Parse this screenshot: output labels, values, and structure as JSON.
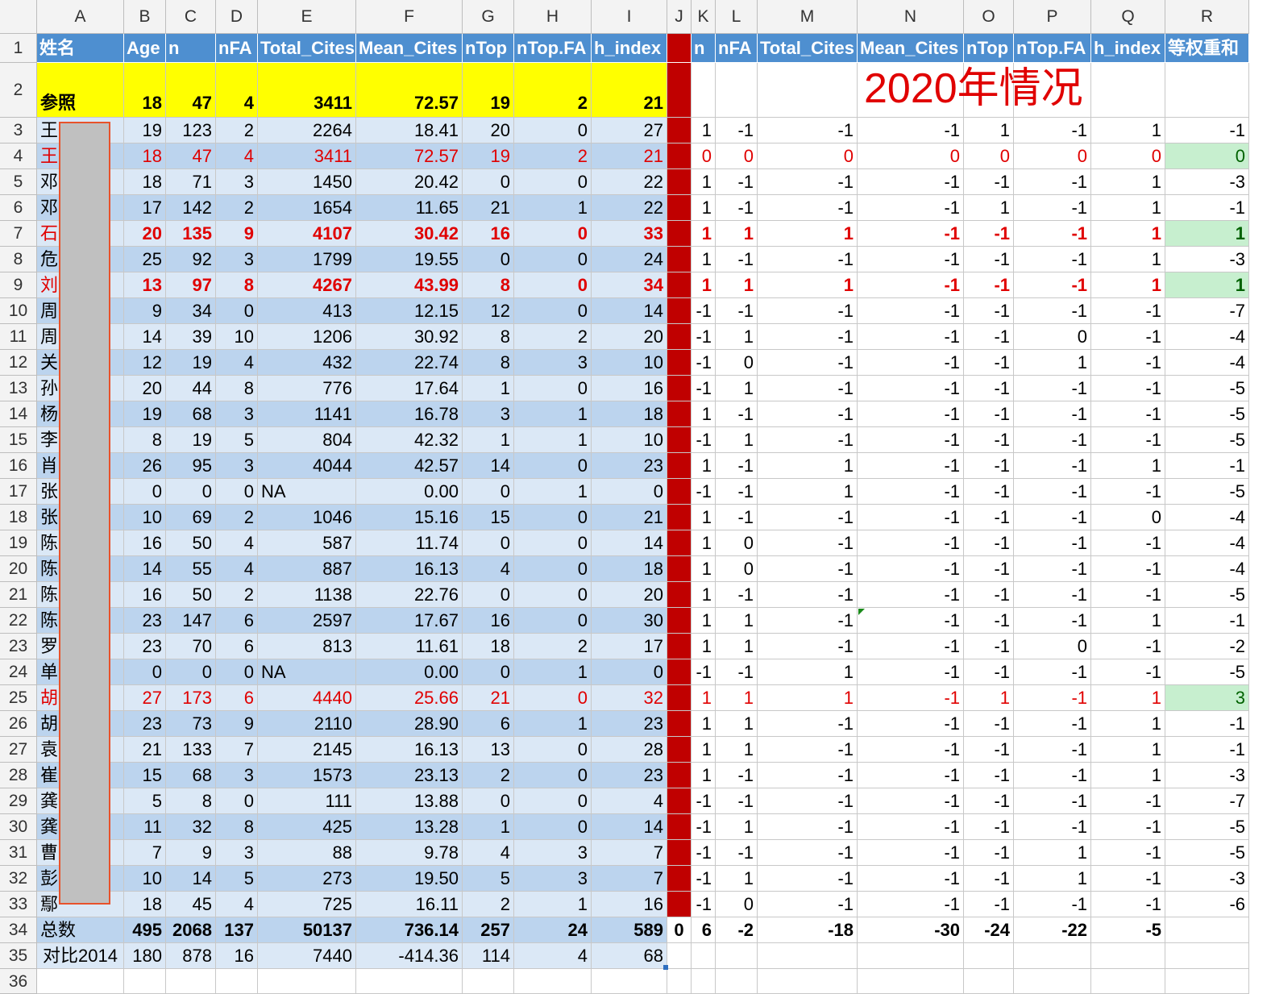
{
  "column_letters": [
    "A",
    "B",
    "C",
    "D",
    "E",
    "F",
    "G",
    "H",
    "I",
    "J",
    "K",
    "L",
    "M",
    "N",
    "O",
    "P",
    "Q",
    "R"
  ],
  "header_row": [
    "姓名",
    "Age",
    "n",
    "nFA",
    "Total_Cites",
    "Mean_Cites",
    "nTop",
    "nTop.FA",
    "h_index",
    "",
    "n",
    "nFA",
    "Total_Cites",
    "Mean_Cites",
    "nTop",
    "nTop.FA",
    "h_index",
    "等权重和"
  ],
  "reference_row": [
    "参照",
    "18",
    "47",
    "4",
    "3411",
    "72.57",
    "19",
    "2",
    "21"
  ],
  "overlay_title": "2020年情况",
  "data_rows": [
    {
      "name": "王",
      "left": [
        "19",
        "123",
        "2",
        "2264",
        "18.41",
        "20",
        "0",
        "27"
      ],
      "right": [
        "1",
        "-1",
        "-1",
        "-1",
        "1",
        "-1",
        "1",
        "-1"
      ],
      "red": false,
      "green": false
    },
    {
      "name": "王",
      "left": [
        "18",
        "47",
        "4",
        "3411",
        "72.57",
        "19",
        "2",
        "21"
      ],
      "right": [
        "0",
        "0",
        "0",
        "0",
        "0",
        "0",
        "0",
        "0"
      ],
      "red": true,
      "bold": false,
      "green": true
    },
    {
      "name": "邓",
      "left": [
        "18",
        "71",
        "3",
        "1450",
        "20.42",
        "0",
        "0",
        "22"
      ],
      "right": [
        "1",
        "-1",
        "-1",
        "-1",
        "-1",
        "-1",
        "1",
        "-3"
      ],
      "red": false,
      "green": false
    },
    {
      "name": "邓",
      "left": [
        "17",
        "142",
        "2",
        "1654",
        "11.65",
        "21",
        "1",
        "22"
      ],
      "right": [
        "1",
        "-1",
        "-1",
        "-1",
        "1",
        "-1",
        "1",
        "-1"
      ],
      "red": false,
      "green": false
    },
    {
      "name": "石",
      "left": [
        "20",
        "135",
        "9",
        "4107",
        "30.42",
        "16",
        "0",
        "33"
      ],
      "right": [
        "1",
        "1",
        "1",
        "-1",
        "-1",
        "-1",
        "1",
        "1"
      ],
      "red": true,
      "bold": true,
      "green": true
    },
    {
      "name": "危",
      "left": [
        "25",
        "92",
        "3",
        "1799",
        "19.55",
        "0",
        "0",
        "24"
      ],
      "right": [
        "1",
        "-1",
        "-1",
        "-1",
        "-1",
        "-1",
        "1",
        "-3"
      ],
      "red": false,
      "green": false
    },
    {
      "name": "刘",
      "left": [
        "13",
        "97",
        "8",
        "4267",
        "43.99",
        "8",
        "0",
        "34"
      ],
      "right": [
        "1",
        "1",
        "1",
        "-1",
        "-1",
        "-1",
        "1",
        "1"
      ],
      "red": true,
      "bold": true,
      "green": true
    },
    {
      "name": "周",
      "left": [
        "9",
        "34",
        "0",
        "413",
        "12.15",
        "12",
        "0",
        "14"
      ],
      "right": [
        "-1",
        "-1",
        "-1",
        "-1",
        "-1",
        "-1",
        "-1",
        "-7"
      ],
      "red": false,
      "green": false
    },
    {
      "name": "周",
      "left": [
        "14",
        "39",
        "10",
        "1206",
        "30.92",
        "8",
        "2",
        "20"
      ],
      "right": [
        "-1",
        "1",
        "-1",
        "-1",
        "-1",
        "0",
        "-1",
        "-4"
      ],
      "red": false,
      "green": false
    },
    {
      "name": "关",
      "left": [
        "12",
        "19",
        "4",
        "432",
        "22.74",
        "8",
        "3",
        "10"
      ],
      "right": [
        "-1",
        "0",
        "-1",
        "-1",
        "-1",
        "1",
        "-1",
        "-4"
      ],
      "red": false,
      "green": false
    },
    {
      "name": "孙",
      "left": [
        "20",
        "44",
        "8",
        "776",
        "17.64",
        "1",
        "0",
        "16"
      ],
      "right": [
        "-1",
        "1",
        "-1",
        "-1",
        "-1",
        "-1",
        "-1",
        "-5"
      ],
      "red": false,
      "green": false
    },
    {
      "name": "杨",
      "left": [
        "19",
        "68",
        "3",
        "1141",
        "16.78",
        "3",
        "1",
        "18"
      ],
      "right": [
        "1",
        "-1",
        "-1",
        "-1",
        "-1",
        "-1",
        "-1",
        "-5"
      ],
      "red": false,
      "green": false
    },
    {
      "name": "李",
      "left": [
        "8",
        "19",
        "5",
        "804",
        "42.32",
        "1",
        "1",
        "10"
      ],
      "right": [
        "-1",
        "1",
        "-1",
        "-1",
        "-1",
        "-1",
        "-1",
        "-5"
      ],
      "red": false,
      "green": false
    },
    {
      "name": "肖",
      "left": [
        "26",
        "95",
        "3",
        "4044",
        "42.57",
        "14",
        "0",
        "23"
      ],
      "right": [
        "1",
        "-1",
        "1",
        "-1",
        "-1",
        "-1",
        "1",
        "-1"
      ],
      "red": false,
      "green": false
    },
    {
      "name": "张",
      "left": [
        "0",
        "0",
        "0",
        "NA",
        "0.00",
        "0",
        "1",
        "0"
      ],
      "right": [
        "-1",
        "-1",
        "1",
        "-1",
        "-1",
        "-1",
        "-1",
        "-5"
      ],
      "red": false,
      "green": false
    },
    {
      "name": "张",
      "left": [
        "10",
        "69",
        "2",
        "1046",
        "15.16",
        "15",
        "0",
        "21"
      ],
      "right": [
        "1",
        "-1",
        "-1",
        "-1",
        "-1",
        "-1",
        "0",
        "-4"
      ],
      "red": false,
      "green": false
    },
    {
      "name": "陈",
      "left": [
        "16",
        "50",
        "4",
        "587",
        "11.74",
        "0",
        "0",
        "14"
      ],
      "right": [
        "1",
        "0",
        "-1",
        "-1",
        "-1",
        "-1",
        "-1",
        "-4"
      ],
      "red": false,
      "green": false
    },
    {
      "name": "陈",
      "left": [
        "14",
        "55",
        "4",
        "887",
        "16.13",
        "4",
        "0",
        "18"
      ],
      "right": [
        "1",
        "0",
        "-1",
        "-1",
        "-1",
        "-1",
        "-1",
        "-4"
      ],
      "red": false,
      "green": false
    },
    {
      "name": "陈",
      "left": [
        "16",
        "50",
        "2",
        "1138",
        "22.76",
        "0",
        "0",
        "20"
      ],
      "right": [
        "1",
        "-1",
        "-1",
        "-1",
        "-1",
        "-1",
        "-1",
        "-5"
      ],
      "red": false,
      "green": false
    },
    {
      "name": "陈",
      "left": [
        "23",
        "147",
        "6",
        "2597",
        "17.67",
        "16",
        "0",
        "30"
      ],
      "right": [
        "1",
        "1",
        "-1",
        "-1",
        "-1",
        "-1",
        "1",
        "-1"
      ],
      "red": false,
      "green": false
    },
    {
      "name": "罗",
      "left": [
        "23",
        "70",
        "6",
        "813",
        "11.61",
        "18",
        "2",
        "17"
      ],
      "right": [
        "1",
        "1",
        "-1",
        "-1",
        "-1",
        "0",
        "-1",
        "-2"
      ],
      "red": false,
      "green": false
    },
    {
      "name": "单",
      "left": [
        "0",
        "0",
        "0",
        "NA",
        "0.00",
        "0",
        "1",
        "0"
      ],
      "right": [
        "-1",
        "-1",
        "1",
        "-1",
        "-1",
        "-1",
        "-1",
        "-5"
      ],
      "red": false,
      "green": false
    },
    {
      "name": "胡",
      "left": [
        "27",
        "173",
        "6",
        "4440",
        "25.66",
        "21",
        "0",
        "32"
      ],
      "right": [
        "1",
        "1",
        "1",
        "-1",
        "1",
        "-1",
        "1",
        "3"
      ],
      "red": true,
      "bold": false,
      "green": true
    },
    {
      "name": "胡",
      "left": [
        "23",
        "73",
        "9",
        "2110",
        "28.90",
        "6",
        "1",
        "23"
      ],
      "right": [
        "1",
        "1",
        "-1",
        "-1",
        "-1",
        "-1",
        "1",
        "-1"
      ],
      "red": false,
      "green": false
    },
    {
      "name": "袁",
      "left": [
        "21",
        "133",
        "7",
        "2145",
        "16.13",
        "13",
        "0",
        "28"
      ],
      "right": [
        "1",
        "1",
        "-1",
        "-1",
        "-1",
        "-1",
        "1",
        "-1"
      ],
      "red": false,
      "green": false
    },
    {
      "name": "崔",
      "left": [
        "15",
        "68",
        "3",
        "1573",
        "23.13",
        "2",
        "0",
        "23"
      ],
      "right": [
        "1",
        "-1",
        "-1",
        "-1",
        "-1",
        "-1",
        "1",
        "-3"
      ],
      "red": false,
      "green": false
    },
    {
      "name": "龚",
      "left": [
        "5",
        "8",
        "0",
        "111",
        "13.88",
        "0",
        "0",
        "4"
      ],
      "right": [
        "-1",
        "-1",
        "-1",
        "-1",
        "-1",
        "-1",
        "-1",
        "-7"
      ],
      "red": false,
      "green": false
    },
    {
      "name": "龚",
      "left": [
        "11",
        "32",
        "8",
        "425",
        "13.28",
        "1",
        "0",
        "14"
      ],
      "right": [
        "-1",
        "1",
        "-1",
        "-1",
        "-1",
        "-1",
        "-1",
        "-5"
      ],
      "red": false,
      "green": false
    },
    {
      "name": "曹",
      "left": [
        "7",
        "9",
        "3",
        "88",
        "9.78",
        "4",
        "3",
        "7"
      ],
      "right": [
        "-1",
        "-1",
        "-1",
        "-1",
        "-1",
        "1",
        "-1",
        "-5"
      ],
      "red": false,
      "green": false
    },
    {
      "name": "彭",
      "left": [
        "10",
        "14",
        "5",
        "273",
        "19.50",
        "5",
        "3",
        "7"
      ],
      "right": [
        "-1",
        "1",
        "-1",
        "-1",
        "-1",
        "1",
        "-1",
        "-3"
      ],
      "red": false,
      "green": false
    },
    {
      "name": "鄢",
      "left": [
        "18",
        "45",
        "4",
        "725",
        "16.11",
        "2",
        "1",
        "16"
      ],
      "right": [
        "-1",
        "0",
        "-1",
        "-1",
        "-1",
        "-1",
        "-1",
        "-6"
      ],
      "red": false,
      "green": false
    }
  ],
  "total_row": {
    "label": "总数",
    "left": [
      "495",
      "2068",
      "137",
      "50137",
      "736.14",
      "257",
      "24",
      "589"
    ],
    "j": "0",
    "right": [
      "6",
      "-2",
      "-18",
      "-30",
      "-24",
      "-22",
      "-5"
    ]
  },
  "compare_row": {
    "label": "对比2014",
    "values": [
      "180",
      "878",
      "16",
      "7440",
      "-414.36",
      "114",
      "4",
      "68"
    ]
  },
  "colors": {
    "header_blue": "#4e8fd0",
    "row_light": "#dbe8f6",
    "row_dark": "#bcd4ee",
    "reference_yellow": "#ffff00",
    "separator_red": "#c00000",
    "highlight_red": "#e00000",
    "green_fill": "#c7efcf"
  }
}
